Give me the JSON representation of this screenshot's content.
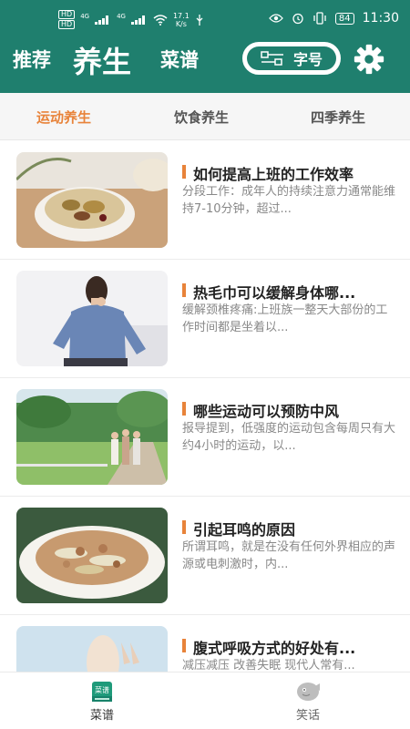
{
  "status_bar": {
    "hd1": "HD",
    "hd2": "HD",
    "net1": "4G",
    "net2": "4G",
    "speed_value": "17.1",
    "speed_unit": "K/s",
    "battery": "84",
    "time": "11:30"
  },
  "header": {
    "tab_left": "推荐",
    "tab_center": "养生",
    "tab_right": "菜谱",
    "font_size_button": "字号"
  },
  "category_tabs": [
    {
      "label": "运动养生",
      "active": true
    },
    {
      "label": "饮食养生",
      "active": false
    },
    {
      "label": "四季养生",
      "active": false
    }
  ],
  "articles": [
    {
      "title": "如何提高上班的工作效率",
      "desc": "分段工作：成年人的持续注意力通常能维持7-10分钟，超过..."
    },
    {
      "title": "热毛巾可以缓解身体哪...",
      "desc": "缓解颈椎疼痛:上班族一整天大部份的工作时间都是坐着以..."
    },
    {
      "title": "哪些运动可以预防中风",
      "desc": "报导提到，低强度的运动包含每周只有大约4小时的运动，以..."
    },
    {
      "title": "引起耳鸣的原因",
      "desc": "所谓耳鸣，就是在没有任何外界相应的声源或电刺激时，内..."
    },
    {
      "title": "腹式呼吸方式的好处有...",
      "desc": "减压减压 改善失眠 现代人常有..."
    }
  ],
  "bottom_nav": {
    "recipes": "菜谱",
    "jokes": "笑话",
    "recipes_icon_text": "菜谱"
  },
  "colors": {
    "header_bg": "#1f7f6e",
    "accent": "#e8833a"
  }
}
